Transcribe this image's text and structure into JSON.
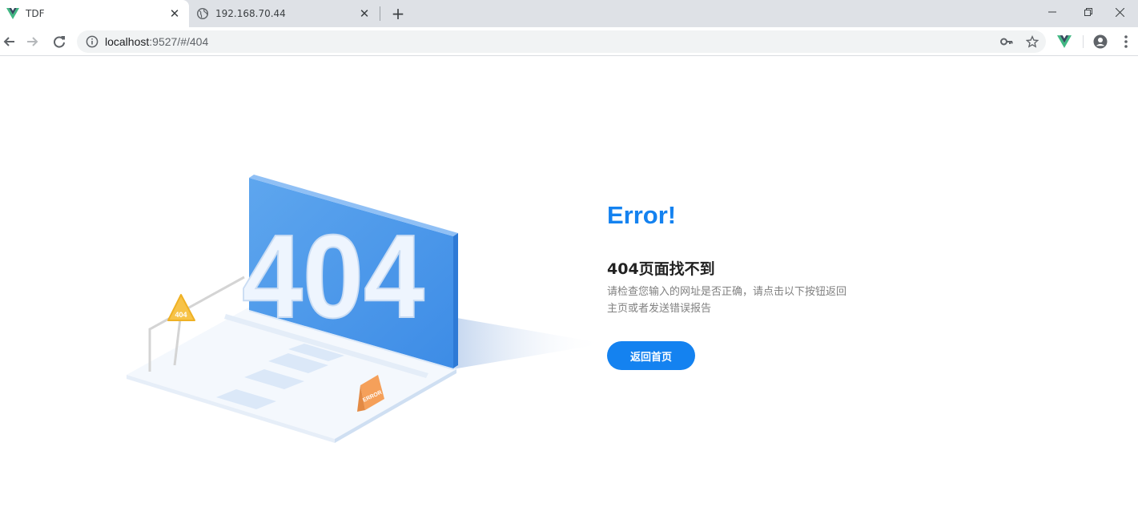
{
  "browser": {
    "tabs": [
      {
        "title": "TDF",
        "icon": "vue-logo-icon"
      },
      {
        "title": "192.168.70.44",
        "icon": "globe-icon"
      }
    ],
    "address": {
      "host": "localhost",
      "rest": ":9527/#/404"
    },
    "colors": {
      "accent": "#1482f0",
      "vue_green": "#41b883",
      "vue_dark": "#35495e"
    }
  },
  "illustration": {
    "big_number": "404",
    "warning_sign_text": "404",
    "error_sign_text": "ERROR"
  },
  "page": {
    "title": "Error!",
    "headline": "404页面找不到",
    "info": "请检查您输入的网址是否正确，请点击以下按钮返回主页或者发送错误报告",
    "home_button": "返回首页"
  }
}
